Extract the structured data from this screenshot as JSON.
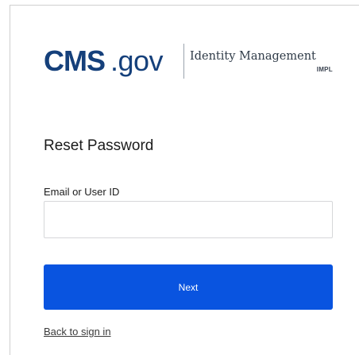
{
  "brand": {
    "cms": "CMS",
    "gov": ".gov",
    "product": "Identity Management",
    "environment": "IMPL"
  },
  "form": {
    "title": "Reset Password",
    "email_label": "Email or User ID",
    "email_value": "",
    "email_placeholder": "",
    "next_label": "Next",
    "back_link_label": "Back to sign in"
  },
  "colors": {
    "brand_navy": "#15407b",
    "primary_button": "#0954e0"
  }
}
